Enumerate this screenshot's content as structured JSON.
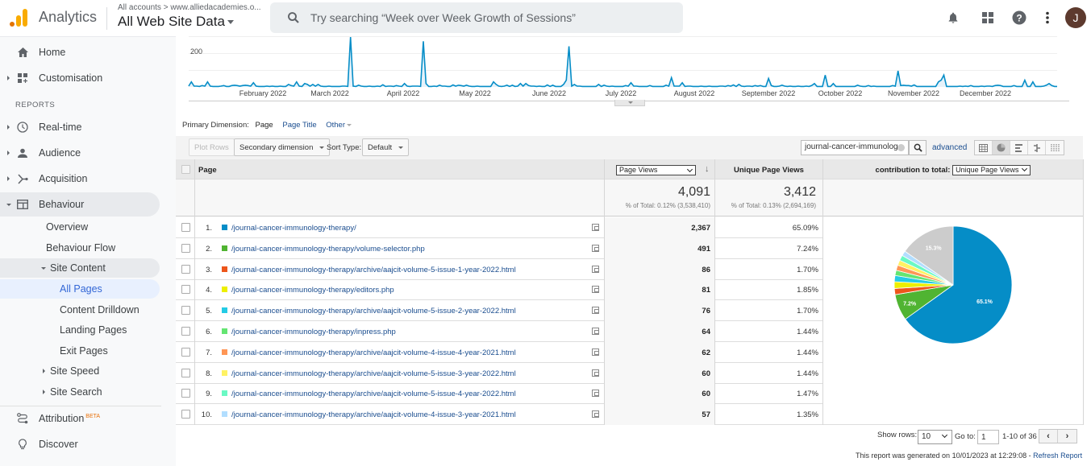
{
  "header": {
    "app_name": "Analytics",
    "breadcrumb": "All accounts > www.alliedacademies.o...",
    "property": "All Web Site Data",
    "search_placeholder": "Try searching “Week over Week Growth of Sessions”",
    "avatar_initial": "J",
    "icons": [
      "bell-icon",
      "apps-grid-icon",
      "help-icon",
      "more-vert-icon"
    ]
  },
  "sidebar": {
    "top_items": [
      {
        "label": "Home",
        "icon": "home-icon"
      },
      {
        "label": "Customisation",
        "icon": "dashboard-add-icon"
      }
    ],
    "reports_label": "REPORTS",
    "report_items": [
      {
        "label": "Real-time",
        "icon": "clock-icon"
      },
      {
        "label": "Audience",
        "icon": "person-icon"
      },
      {
        "label": "Acquisition",
        "icon": "acquisition-icon"
      },
      {
        "label": "Behaviour",
        "icon": "behaviour-icon"
      }
    ],
    "behaviour_sub": [
      "Overview",
      "Behaviour Flow",
      "Site Content"
    ],
    "site_content_sub": [
      "All Pages",
      "Content Drilldown",
      "Landing Pages",
      "Exit Pages"
    ],
    "behaviour_sub2": [
      "Site Speed",
      "Site Search"
    ],
    "bottom_items": [
      {
        "label": "Attribution",
        "badge": "BETA",
        "icon": "attribution-icon"
      },
      {
        "label": "Discover",
        "icon": "lightbulb-icon"
      }
    ]
  },
  "chart_data": {
    "type": "area",
    "title": "",
    "ylabel": "",
    "y_tick_labels": [
      "200"
    ],
    "x_tick_labels": [
      "February 2022",
      "March 2022",
      "April 2022",
      "May 2022",
      "June 2022",
      "July 2022",
      "August 2022",
      "September 2022",
      "October 2022",
      "November 2022",
      "December 2022"
    ],
    "ylim": [
      0,
      300
    ],
    "series": [
      {
        "name": "Page Views",
        "color": "#058dc7",
        "values": [
          5,
          30,
          5,
          5,
          3,
          8,
          5,
          30,
          5,
          3,
          3,
          3,
          5,
          8,
          3,
          3,
          8,
          10,
          8,
          5,
          8,
          10,
          8,
          5,
          25,
          5,
          3,
          3,
          3,
          5,
          3,
          5,
          3,
          3,
          5,
          3,
          3,
          15,
          8,
          5,
          30,
          5,
          3,
          20,
          15,
          5,
          15,
          5,
          15,
          5,
          3,
          3,
          5,
          3,
          3,
          3,
          3,
          5,
          5,
          3,
          330,
          5,
          3,
          10,
          5,
          3,
          3,
          5,
          3,
          3,
          5,
          3,
          13,
          3,
          5,
          5,
          3,
          8,
          5,
          3,
          20,
          5,
          3,
          5,
          5,
          5,
          3,
          270,
          20,
          3,
          3,
          5,
          3,
          10,
          5,
          5,
          3,
          3,
          12,
          5,
          10,
          8,
          5,
          10,
          5,
          3,
          3,
          5,
          3,
          3,
          3,
          3,
          3,
          30,
          15,
          5,
          3,
          5,
          10,
          3,
          10,
          3,
          5,
          20,
          5,
          20,
          8,
          5,
          5,
          3,
          5,
          3,
          3,
          12,
          3,
          10,
          3,
          3,
          3,
          15,
          40,
          240,
          5,
          15,
          5,
          5,
          3,
          3,
          3,
          3,
          3,
          3,
          15,
          3,
          10,
          5,
          3,
          5,
          3,
          3,
          3,
          3,
          8,
          5,
          25,
          5,
          5,
          3,
          3,
          3,
          3,
          8,
          3,
          3,
          3,
          3,
          3,
          10,
          5,
          55,
          5,
          5,
          5,
          25,
          3,
          5,
          5,
          3,
          3,
          3,
          5,
          3,
          3,
          5,
          3,
          3,
          3,
          5,
          5,
          3,
          8,
          5,
          12,
          3,
          15,
          5,
          3,
          5,
          5,
          3,
          8,
          5,
          8,
          3,
          3,
          50,
          8,
          3,
          3,
          5,
          10,
          5,
          3,
          5,
          3,
          3,
          5,
          3,
          3,
          5,
          3,
          8,
          20,
          3,
          3,
          3,
          70,
          3,
          3,
          20,
          3,
          3,
          3,
          3,
          3,
          3,
          3,
          3,
          10,
          5,
          3,
          3,
          8,
          3,
          5,
          3,
          3,
          3,
          3,
          3,
          3,
          8,
          5,
          95,
          8,
          10,
          8,
          8,
          5,
          12,
          3,
          3,
          3,
          3,
          3,
          3,
          3,
          3,
          30,
          40,
          70,
          3,
          3,
          3,
          3,
          3,
          5,
          3,
          5,
          3,
          8,
          3,
          3,
          3,
          5,
          3,
          5,
          5,
          3,
          8,
          10,
          8,
          3,
          3,
          3,
          3,
          8,
          3,
          3,
          3,
          40,
          3,
          3,
          30,
          3,
          3,
          3,
          5,
          10,
          20,
          8,
          3,
          3
        ]
      }
    ]
  },
  "primary_dimension": {
    "label": "Primary Dimension:",
    "current": "Page",
    "options": [
      "Page Title",
      "Other"
    ]
  },
  "toolbar": {
    "plot_rows": "Plot Rows",
    "secondary_dimension": "Secondary dimension",
    "sort_type_label": "Sort Type:",
    "sort_type_value": "Default",
    "filter_value": "journal-cancer-immunolog",
    "advanced": "advanced",
    "view_icons": [
      "table-view-icon",
      "pie-view-icon",
      "performance-view-icon",
      "comparison-view-icon",
      "pivot-view-icon"
    ]
  },
  "table": {
    "col_page": "Page",
    "col_metric_select": "Page Views",
    "col_upv": "Unique Page Views",
    "col_contrib_label": "contribution to total:",
    "col_contrib_select": "Unique Page Views",
    "totals": {
      "page_views": "4,091",
      "page_views_sub": "% of Total: 0.12% (3,538,410)",
      "upv": "3,412",
      "upv_sub": "% of Total: 0.13% (2,694,169)"
    },
    "rows": [
      {
        "num": "1.",
        "page": "/journal-cancer-immunology-therapy/",
        "color": "#058dc7",
        "pv": "2,367",
        "upv": "65.09%"
      },
      {
        "num": "2.",
        "page": "/journal-cancer-immunology-therapy/volume-selector.php",
        "color": "#50b432",
        "pv": "491",
        "upv": "7.24%"
      },
      {
        "num": "3.",
        "page": "/journal-cancer-immunology-therapy/archive/aajcit-volume-5-issue-1-year-2022.html",
        "color": "#ed561b",
        "pv": "86",
        "upv": "1.70%"
      },
      {
        "num": "4.",
        "page": "/journal-cancer-immunology-therapy/editors.php",
        "color": "#edef00",
        "pv": "81",
        "upv": "1.85%"
      },
      {
        "num": "5.",
        "page": "/journal-cancer-immunology-therapy/archive/aajcit-volume-5-issue-2-year-2022.html",
        "color": "#24cbe5",
        "pv": "76",
        "upv": "1.70%"
      },
      {
        "num": "6.",
        "page": "/journal-cancer-immunology-therapy/inpress.php",
        "color": "#64e572",
        "pv": "64",
        "upv": "1.44%"
      },
      {
        "num": "7.",
        "page": "/journal-cancer-immunology-therapy/archive/aajcit-volume-4-issue-4-year-2021.html",
        "color": "#ff9655",
        "pv": "62",
        "upv": "1.44%"
      },
      {
        "num": "8.",
        "page": "/journal-cancer-immunology-therapy/archive/aajcit-volume-5-issue-3-year-2022.html",
        "color": "#fff263",
        "pv": "60",
        "upv": "1.44%"
      },
      {
        "num": "9.",
        "page": "/journal-cancer-immunology-therapy/archive/aajcit-volume-5-issue-4-year-2022.html",
        "color": "#6af9c4",
        "pv": "60",
        "upv": "1.47%"
      },
      {
        "num": "10.",
        "page": "/journal-cancer-immunology-therapy/archive/aajcit-volume-4-issue-3-year-2021.html",
        "color": "#b2deff",
        "pv": "57",
        "upv": "1.35%"
      }
    ]
  },
  "pie": {
    "slices": [
      {
        "label": "65.1%",
        "value": 65.09,
        "color": "#058dc7"
      },
      {
        "label": "7.2%",
        "value": 7.24,
        "color": "#50b432"
      },
      {
        "label": "",
        "value": 1.7,
        "color": "#ed561b"
      },
      {
        "label": "",
        "value": 1.85,
        "color": "#edef00"
      },
      {
        "label": "",
        "value": 1.7,
        "color": "#24cbe5"
      },
      {
        "label": "",
        "value": 1.44,
        "color": "#64e572"
      },
      {
        "label": "",
        "value": 1.44,
        "color": "#ff9655"
      },
      {
        "label": "",
        "value": 1.44,
        "color": "#fff263"
      },
      {
        "label": "",
        "value": 1.47,
        "color": "#6af9c4"
      },
      {
        "label": "",
        "value": 1.35,
        "color": "#b2deff"
      },
      {
        "label": "15.3%",
        "value": 15.28,
        "color": "#cccccc"
      }
    ]
  },
  "pager": {
    "show_rows_label": "Show rows:",
    "show_rows_value": "10",
    "goto_label": "Go to:",
    "goto_value": "1",
    "range": "1-10 of 36",
    "prev": "‹",
    "next": "›"
  },
  "footer": {
    "generated": "This report was generated on 10/01/2023 at 12:29:08 - ",
    "refresh": "Refresh Report"
  }
}
